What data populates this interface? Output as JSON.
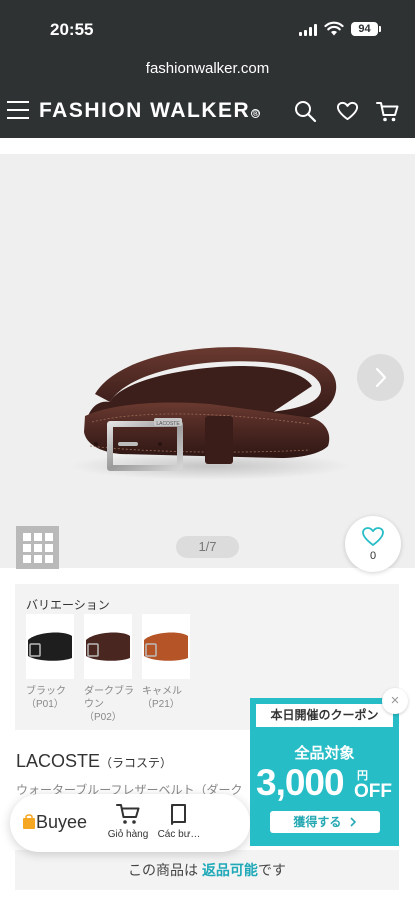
{
  "status_bar": {
    "time": "20:55",
    "battery": "94"
  },
  "browser": {
    "url": "fashionwalker.com"
  },
  "header": {
    "logo_text": "FASHION WALKER",
    "logo_mark": "®"
  },
  "gallery": {
    "counter": "1/7",
    "favorite_count": "0"
  },
  "variation": {
    "title": "バリエーション",
    "items": [
      {
        "label": "ブラック（P01）",
        "color": "#1e1e1e"
      },
      {
        "label": "ダークブラウン（P02）",
        "color": "#4a2621"
      },
      {
        "label": "キャメル（P21）",
        "color": "#b55426"
      }
    ]
  },
  "product": {
    "brand": "LACOSTE",
    "brand_kana": "（ラコステ）",
    "name": "ウォーターブルーフレザーベルト（ダーク"
  },
  "return_notice": {
    "prefix": "この商品は ",
    "highlight": "返品可能",
    "suffix": "です"
  },
  "buyee": {
    "logo": "Buyee",
    "items": [
      {
        "label": "Giỏ hàng",
        "icon": "cart-icon"
      },
      {
        "label": "Các bư…",
        "icon": "book-icon"
      }
    ]
  },
  "coupon": {
    "heading": "本日開催のクーポン",
    "subtitle": "全品対象",
    "amount": "3,000",
    "yen": "円",
    "off": "OFF",
    "button": "獲得する",
    "close": "×"
  },
  "colors": {
    "accent": "#27bdc7",
    "header_bg": "#2f3233",
    "belt_main": "#4a2621"
  }
}
